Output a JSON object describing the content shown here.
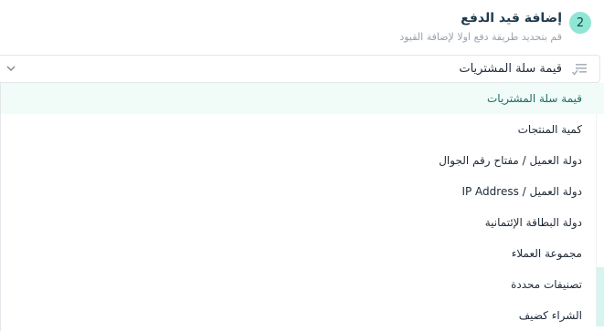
{
  "step": {
    "number": "2",
    "title": "إضافة قيد الدفع",
    "subtitle": "قم بتحديد طريقة دفع اولا لإضافة القيود"
  },
  "select": {
    "selected_value": "قيمة سلة المشتريات",
    "icon": "filter-list-icon",
    "chevron_icon": "chevron-down-icon"
  },
  "options": [
    "قيمة سلة المشتريات",
    "كمية المنتجات",
    "دولة العميل / مفتاح رقم الجوال",
    "دولة العميل / IP Address",
    "دولة البطاقة الإئتمانية",
    "مجموعة العملاء",
    "تصنيفات محددة",
    "الشراء كضيف"
  ],
  "colors": {
    "accent": "#8fe6d5",
    "active_bg": "#f1fbf8",
    "active_text": "#1b6e63"
  }
}
